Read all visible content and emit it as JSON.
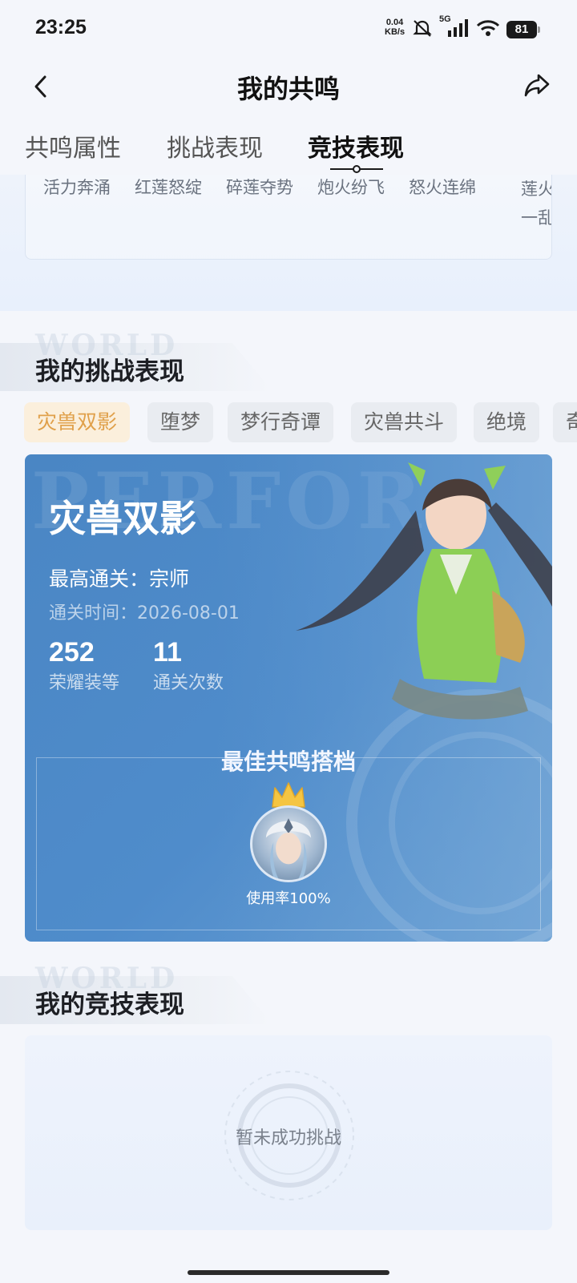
{
  "status_bar": {
    "time": "23:25",
    "net_speed_value": "0.04",
    "net_speed_unit": "KB/s",
    "network_type": "5G",
    "battery": "81"
  },
  "header": {
    "title": "我的共鸣"
  },
  "tabs": [
    {
      "label": "共鸣属性",
      "active": false
    },
    {
      "label": "挑战表现",
      "active": false
    },
    {
      "label": "竞技表现",
      "active": true
    }
  ],
  "skills": [
    "活力奔涌",
    "红莲怒绽",
    "碎莲夺势",
    "炮火纷飞",
    "怒火连绵",
    "莲火一乱"
  ],
  "challenge_section": {
    "title": "我的挑战表现",
    "watermark": "WORLD",
    "chips": [
      "灾兽双影",
      "堕梦",
      "梦行奇谭",
      "灾兽共斗",
      "绝境",
      "奇"
    ],
    "active_chip": 0,
    "card": {
      "watermark": "PERFOR",
      "title": "灾兽双影",
      "highest_clear": "最高通关：宗师",
      "clear_time": "通关时间：2026-08-01",
      "stats": [
        {
          "value": "252",
          "label": "荣耀装等"
        },
        {
          "value": "11",
          "label": "通关次数"
        }
      ],
      "partner_title": "最佳共鸣搭档",
      "usage_rate": "使用率100%"
    }
  },
  "competition_section": {
    "title": "我的竞技表现",
    "watermark": "WORLD",
    "empty_text": "暂未成功挑战"
  },
  "colors": {
    "active_chip_bg": "#fbefdc",
    "active_chip_text": "#e0a04a",
    "card_blue": "#4a86c4"
  }
}
